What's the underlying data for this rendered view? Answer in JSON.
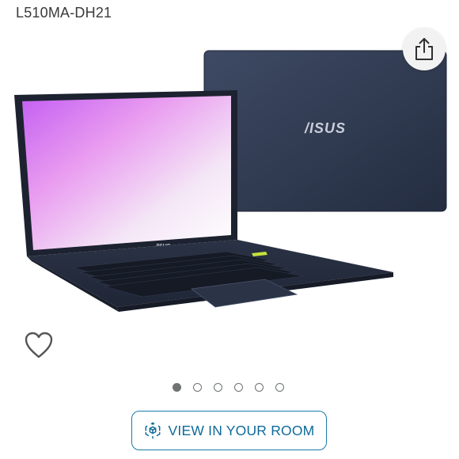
{
  "product": {
    "model": "L510MA-DH21",
    "brand_logo": "/ISUS"
  },
  "icons": {
    "share": "share-icon",
    "heart": "heart-icon",
    "ar": "ar-cube-icon"
  },
  "carousel": {
    "total": 6,
    "active_index": 0
  },
  "ar_button": {
    "label": "VIEW IN YOUR ROOM"
  },
  "colors": {
    "accent": "#1a7aa8",
    "dot": "#6f7373",
    "laptop_body": "#2c3447"
  }
}
